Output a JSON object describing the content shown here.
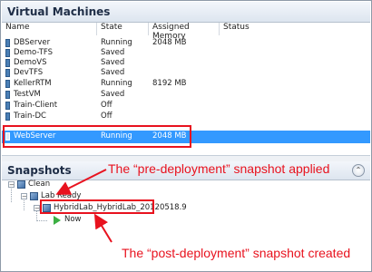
{
  "vm_panel": {
    "title": "Virtual Machines",
    "columns": [
      "Name",
      "State",
      "Assigned Memory",
      "Status"
    ],
    "rows": [
      {
        "name": "DBServer",
        "state": "Running",
        "memory": "2048 MB",
        "status": ""
      },
      {
        "name": "Demo-TFS",
        "state": "Saved",
        "memory": "",
        "status": ""
      },
      {
        "name": "DemoVS",
        "state": "Saved",
        "memory": "",
        "status": ""
      },
      {
        "name": "DevTFS",
        "state": "Saved",
        "memory": "",
        "status": ""
      },
      {
        "name": "KellerRTM",
        "state": "Running",
        "memory": "8192 MB",
        "status": ""
      },
      {
        "name": "TestVM",
        "state": "Saved",
        "memory": "",
        "status": ""
      },
      {
        "name": "Train-Client",
        "state": "Off",
        "memory": "",
        "status": ""
      },
      {
        "name": "Train-DC",
        "state": "Off",
        "memory": "",
        "status": ""
      },
      {
        "name": "WebServer",
        "state": "Running",
        "memory": "2048 MB",
        "status": ""
      }
    ],
    "selected_row": "WebServer",
    "selection_color": "#3399ff"
  },
  "snapshots_panel": {
    "title": "Snapshots",
    "collapse_icon": "chevron-up-icon",
    "tree": {
      "root": "Clean",
      "child": "Lab Ready",
      "grandchild": "HybridLab_HybridLab_20120518.9",
      "current": "Now"
    }
  },
  "annotations": {
    "pre_deployment": "The “pre-deployment” snapshot applied",
    "post_deployment": "The “post-deployment” snapshot created",
    "color": "#e8121e"
  }
}
